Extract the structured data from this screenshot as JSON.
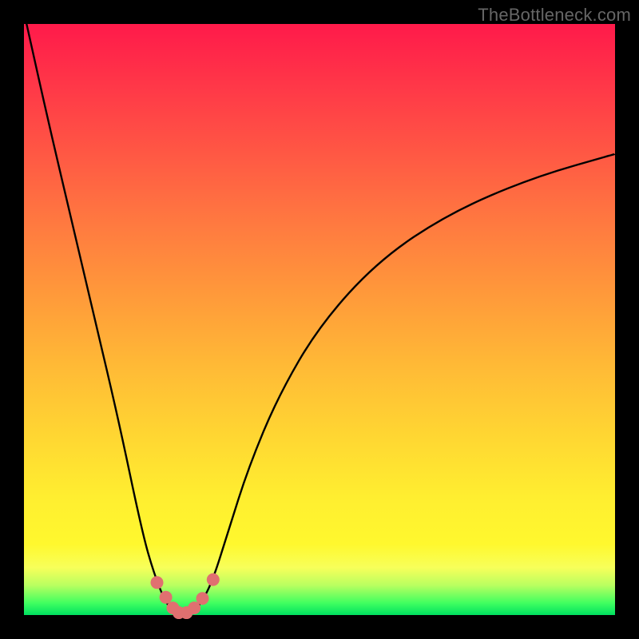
{
  "watermark": "TheBottleneck.com",
  "chart_data": {
    "type": "line",
    "title": "",
    "xlabel": "",
    "ylabel": "",
    "xlim": [
      0,
      1
    ],
    "ylim": [
      0,
      1
    ],
    "series": [
      {
        "name": "bottleneck-curve",
        "x": [
          0.0,
          0.04,
          0.08,
          0.12,
          0.16,
          0.2,
          0.22,
          0.24,
          0.255,
          0.27,
          0.285,
          0.3,
          0.32,
          0.345,
          0.38,
          0.43,
          0.5,
          0.6,
          0.72,
          0.86,
          1.0
        ],
        "y": [
          1.02,
          0.84,
          0.67,
          0.5,
          0.33,
          0.14,
          0.07,
          0.02,
          0.005,
          0.0,
          0.005,
          0.02,
          0.06,
          0.14,
          0.25,
          0.37,
          0.49,
          0.6,
          0.68,
          0.74,
          0.78
        ]
      }
    ],
    "markers": {
      "name": "bottleneck-dots",
      "color": "#e07070",
      "points": [
        {
          "x": 0.225,
          "y": 0.055
        },
        {
          "x": 0.24,
          "y": 0.03
        },
        {
          "x": 0.252,
          "y": 0.012
        },
        {
          "x": 0.262,
          "y": 0.004
        },
        {
          "x": 0.275,
          "y": 0.004
        },
        {
          "x": 0.288,
          "y": 0.012
        },
        {
          "x": 0.302,
          "y": 0.028
        },
        {
          "x": 0.32,
          "y": 0.06
        }
      ]
    }
  }
}
